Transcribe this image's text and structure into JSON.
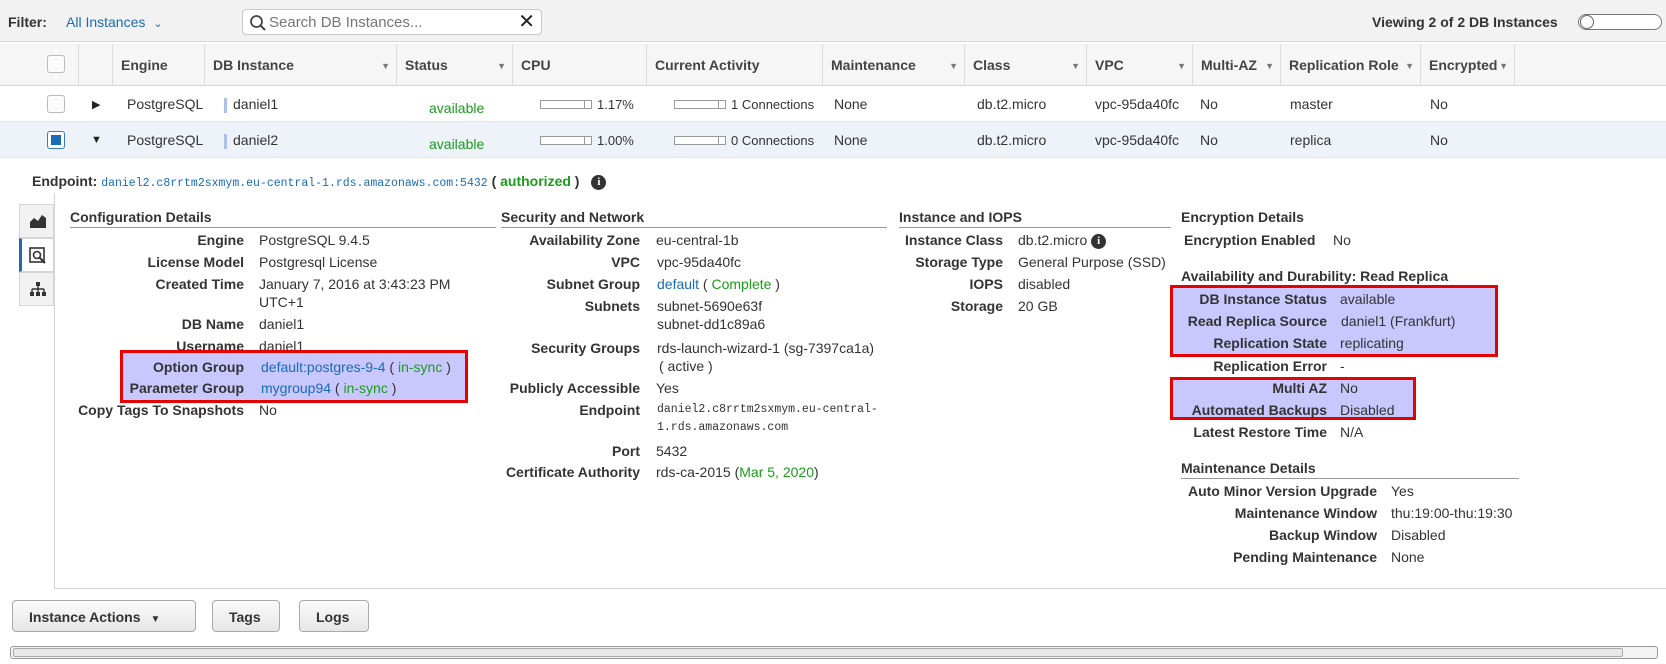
{
  "filter": {
    "label": "Filter:",
    "value": "All Instances",
    "search_placeholder": "Search DB Instances...",
    "viewing": "Viewing 2 of 2 DB Instances"
  },
  "columns": {
    "engine": "Engine",
    "db_instance": "DB Instance",
    "status": "Status",
    "cpu": "CPU",
    "activity": "Current Activity",
    "maintenance": "Maintenance",
    "class": "Class",
    "vpc": "VPC",
    "multiaz": "Multi-AZ",
    "replication": "Replication Role",
    "encrypted": "Encrypted"
  },
  "rows": [
    {
      "engine": "PostgreSQL",
      "instance": "daniel1",
      "status": "available",
      "cpu": "1.17%",
      "cpu_fraction": 0.0117,
      "activity": "1 Connections",
      "maintenance": "None",
      "class": "db.t2.micro",
      "vpc": "vpc-95da40fc",
      "multiaz": "No",
      "role": "master",
      "encrypted": "No",
      "selected": false
    },
    {
      "engine": "PostgreSQL",
      "instance": "daniel2",
      "status": "available",
      "cpu": "1.00%",
      "cpu_fraction": 0.01,
      "activity": "0 Connections",
      "maintenance": "None",
      "class": "db.t2.micro",
      "vpc": "vpc-95da40fc",
      "multiaz": "No",
      "role": "replica",
      "encrypted": "No",
      "selected": true
    }
  ],
  "endpoint": {
    "label": "Endpoint:",
    "value": "daniel2.c8rrtm2sxmym.eu-central-1.rds.amazonaws.com:5432",
    "open": "(",
    "auth": "authorized",
    "close": ")"
  },
  "config": {
    "title": "Configuration Details",
    "engine_k": "Engine",
    "engine_v": "PostgreSQL 9.4.5",
    "license_k": "License Model",
    "license_v": "Postgresql License",
    "created_k": "Created Time",
    "created_v1": "January 7, 2016 at 3:43:23 PM",
    "created_v2": "UTC+1",
    "dbname_k": "DB Name",
    "dbname_v": "daniel1",
    "username_k": "Username",
    "username_v": "daniel1",
    "optgroup_k": "Option Group",
    "optgroup_v": "default:postgres-9-4",
    "optgroup_s": "in-sync",
    "paramgroup_k": "Parameter Group",
    "paramgroup_v": "mygroup94",
    "paramgroup_s": "in-sync",
    "copytags_k": "Copy Tags To Snapshots",
    "copytags_v": "No"
  },
  "security": {
    "title": "Security and Network",
    "az_k": "Availability Zone",
    "az_v": "eu-central-1b",
    "vpc_k": "VPC",
    "vpc_v": "vpc-95da40fc",
    "subnetgroup_k": "Subnet Group",
    "subnetgroup_v": "default",
    "subnetgroup_s": "Complete",
    "subnets_k": "Subnets",
    "subnet1": "subnet-5690e63f",
    "subnet2": "subnet-dd1c89a6",
    "sg_k": "Security Groups",
    "sg_v": "rds-launch-wizard-1 (sg-7397ca1a)",
    "sg_s": "( active )",
    "public_k": "Publicly Accessible",
    "public_v": "Yes",
    "endpoint_k": "Endpoint",
    "endpoint_v1": "daniel2.c8rrtm2sxmym.eu-central-",
    "endpoint_v2": "1.rds.amazonaws.com",
    "port_k": "Port",
    "port_v": "5432",
    "ca_k": "Certificate Authority",
    "ca_v": "rds-ca-2015",
    "ca_date": "Mar 5, 2020"
  },
  "instance": {
    "title": "Instance and IOPS",
    "class_k": "Instance Class",
    "class_v": "db.t2.micro",
    "storage_type_k": "Storage Type",
    "storage_type_v": "General Purpose (SSD)",
    "iops_k": "IOPS",
    "iops_v": "disabled",
    "storage_k": "Storage",
    "storage_v": "20 GB"
  },
  "encryption": {
    "title": "Encryption Details",
    "enabled_k": "Encryption Enabled",
    "enabled_v": "No"
  },
  "availability": {
    "title": "Availability and Durability: Read Replica",
    "status_k": "DB Instance Status",
    "status_v": "available",
    "source_k": "Read Replica Source",
    "source_v": "daniel1 (Frankfurt)",
    "state_k": "Replication State",
    "state_v": "replicating",
    "error_k": "Replication Error",
    "error_v": "-",
    "multiaz_k": "Multi AZ",
    "multiaz_v": "No",
    "backups_k": "Automated Backups",
    "backups_v": "Disabled",
    "restore_k": "Latest Restore Time",
    "restore_v": "N/A"
  },
  "maintenance": {
    "title": "Maintenance Details",
    "autominor_k": "Auto Minor Version Upgrade",
    "autominor_v": "Yes",
    "window_k": "Maintenance Window",
    "window_v": "thu:19:00-thu:19:30",
    "backup_k": "Backup Window",
    "backup_v": "Disabled",
    "pending_k": "Pending Maintenance",
    "pending_v": "None"
  },
  "buttons": {
    "instance_actions": "Instance Actions",
    "tags": "Tags",
    "logs": "Logs"
  },
  "colors": {
    "link": "#1a6bb5",
    "ok": "#1b9b1b",
    "error": "#d00000",
    "highlight_fill": "#c8c8ff",
    "highlight_border": "#e60000"
  }
}
